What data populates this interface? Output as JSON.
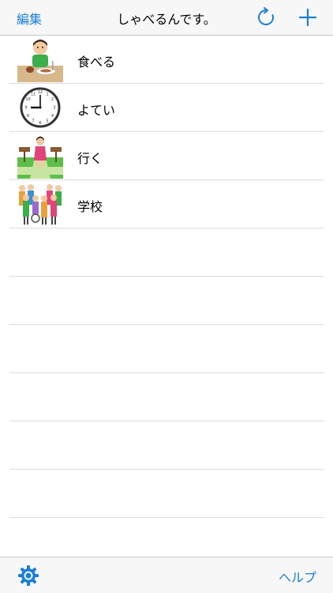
{
  "navbar": {
    "edit_label": "編集",
    "title": "しゃべるんです。",
    "refresh_icon": "refresh-icon",
    "add_icon": "plus-icon"
  },
  "list": {
    "items": [
      {
        "label": "食べる",
        "image": "eating-child-illustration"
      },
      {
        "label": "よてい",
        "image": "clock-illustration"
      },
      {
        "label": "行く",
        "image": "walking-crossroads-illustration"
      },
      {
        "label": "学校",
        "image": "school-group-illustration"
      }
    ],
    "empty_rows": 7
  },
  "toolbar": {
    "settings_icon": "gear-icon",
    "help_label": "ヘルプ"
  },
  "colors": {
    "accent": "#1a7fd6",
    "bar_background": "#f7f7f7",
    "separator": "#dcdcdc"
  }
}
